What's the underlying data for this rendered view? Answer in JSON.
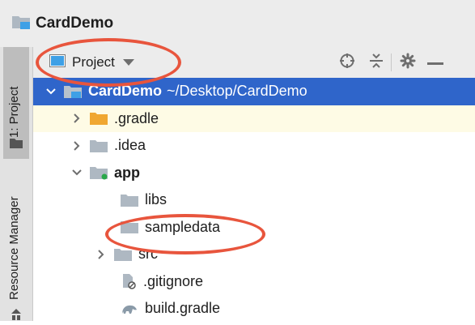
{
  "app": {
    "project_name": "CardDemo"
  },
  "side_tabs": {
    "project_tab": "1: Project",
    "resource_manager_tab": "Resource Manager"
  },
  "toolbar": {
    "view_mode": "Project"
  },
  "tree": {
    "root_name": "CardDemo",
    "root_path": "~/Desktop/CardDemo",
    "gradle": ".gradle",
    "idea": ".idea",
    "app": "app",
    "libs": "libs",
    "sampledata": "sampledata",
    "src": "src",
    "gitignore": ".gitignore",
    "build_gradle": "build.gradle"
  },
  "colors": {
    "selection": "#2f65ca",
    "highlight_row": "#fefbe5",
    "annotation": "#e8553d",
    "folder_orange": "#f0a731",
    "folder_blue": "#3ea0e6"
  }
}
